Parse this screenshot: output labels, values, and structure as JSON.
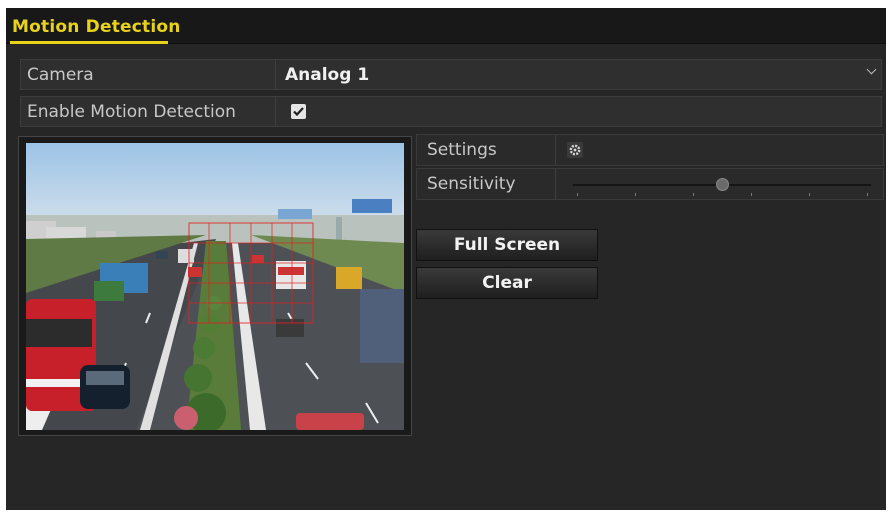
{
  "window": {
    "title": "Motion Detection"
  },
  "camera": {
    "label": "Camera",
    "value": "Analog 1"
  },
  "enable": {
    "label": "Enable Motion Detection",
    "checked": true
  },
  "settings": {
    "label": "Settings",
    "icon": "gear-icon"
  },
  "sensitivity": {
    "label": "Sensitivity",
    "level": 0.5,
    "ticks": 6
  },
  "buttons": {
    "full_screen": "Full Screen",
    "clear": "Clear"
  },
  "colors": {
    "accent": "#e8d21a",
    "panel": "#262626",
    "detection_grid": "#e02020"
  }
}
